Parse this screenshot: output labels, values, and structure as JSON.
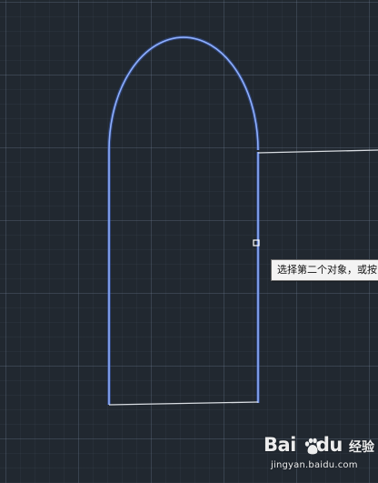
{
  "command_prompt": {
    "text": "选择第二个对象，或按"
  },
  "watermark": {
    "logo_left": "Bai",
    "logo_right": "du",
    "product": "经验",
    "url": "jingyan.baidu.com"
  },
  "colors": {
    "background": "#212830",
    "selected_outline": "#6e93ff",
    "unselected_line": "#d9dde2",
    "grip": "#ffffff"
  },
  "icons": {
    "watermark_paw": "paw-icon"
  }
}
